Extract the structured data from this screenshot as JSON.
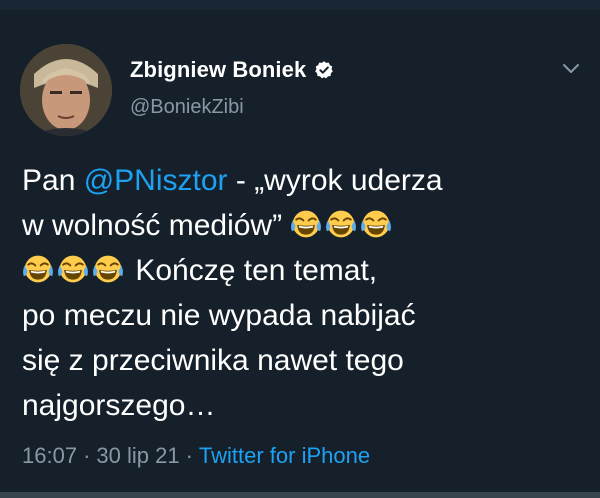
{
  "author": {
    "display_name": "Zbigniew Boniek",
    "handle": "@BoniekZibi",
    "verified": true
  },
  "icons": {
    "verified": "verified-badge-icon",
    "more": "chevron-down-icon",
    "emoji": "face-with-tears-of-joy-emoji"
  },
  "tweet": {
    "line1_prefix": "Pan ",
    "mention": "@PNisztor",
    "line1_suffix": " - „wyrok uderza",
    "line2_text": "w wolność mediów”",
    "line3_text": "Kończę ten temat,",
    "line4": "po meczu nie wypada nabijać",
    "line5": "się z przeciwnika nawet tego",
    "line6": "najgorszego…"
  },
  "meta": {
    "time": "16:07",
    "date": "30 lip 21",
    "separator": "·",
    "source": "Twitter for iPhone"
  },
  "colors": {
    "background": "#15202b",
    "accent": "#1da1f2",
    "secondary_text": "#8899a6",
    "primary_text": "#ffffff"
  }
}
